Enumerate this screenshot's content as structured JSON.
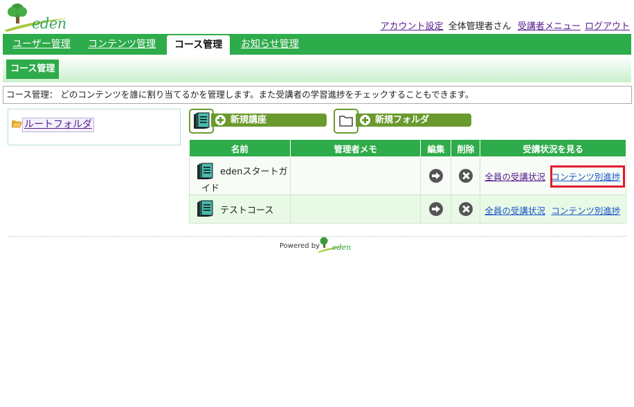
{
  "brand": {
    "logo_text": "eden",
    "primary": "#2eab4a",
    "button": "#6a9a2e",
    "highlight": "#e11b2a"
  },
  "topnav": {
    "account_settings": "アカウント設定",
    "user_name": "全体管理者さん",
    "learner_menu": "受講者メニュー",
    "logout": "ログアウト"
  },
  "tabs": [
    {
      "label": "ユーザー管理",
      "active": false
    },
    {
      "label": "コンテンツ管理",
      "active": false
    },
    {
      "label": "コース管理",
      "active": true
    },
    {
      "label": "お知らせ管理",
      "active": false
    }
  ],
  "subtab": {
    "label": "コース管理"
  },
  "description": "コース管理： どのコンテンツを誰に割り当てるかを管理します。また受講者の学習進捗をチェックすることもできます。",
  "folder_tree": {
    "root": "ルートフォルダ"
  },
  "actions": {
    "new_course": "新規講座",
    "new_folder": "新規フォルダ"
  },
  "table": {
    "headers": [
      "名前",
      "管理者メモ",
      "編集",
      "削除",
      "受講状況を見る"
    ],
    "rows": [
      {
        "name": "edenスタートガイド",
        "name_line1": "edenスタートガ",
        "name_line2": "イド",
        "memo": "",
        "all_status": "全員の受講状況",
        "by_content": "コンテンツ別進捗"
      },
      {
        "name": "テストコース",
        "memo": "",
        "all_status": "全員の受講状況",
        "by_content": "コンテンツ別進捗"
      }
    ]
  },
  "footer": {
    "powered_by": "Powered by",
    "logo_text": "eden"
  }
}
